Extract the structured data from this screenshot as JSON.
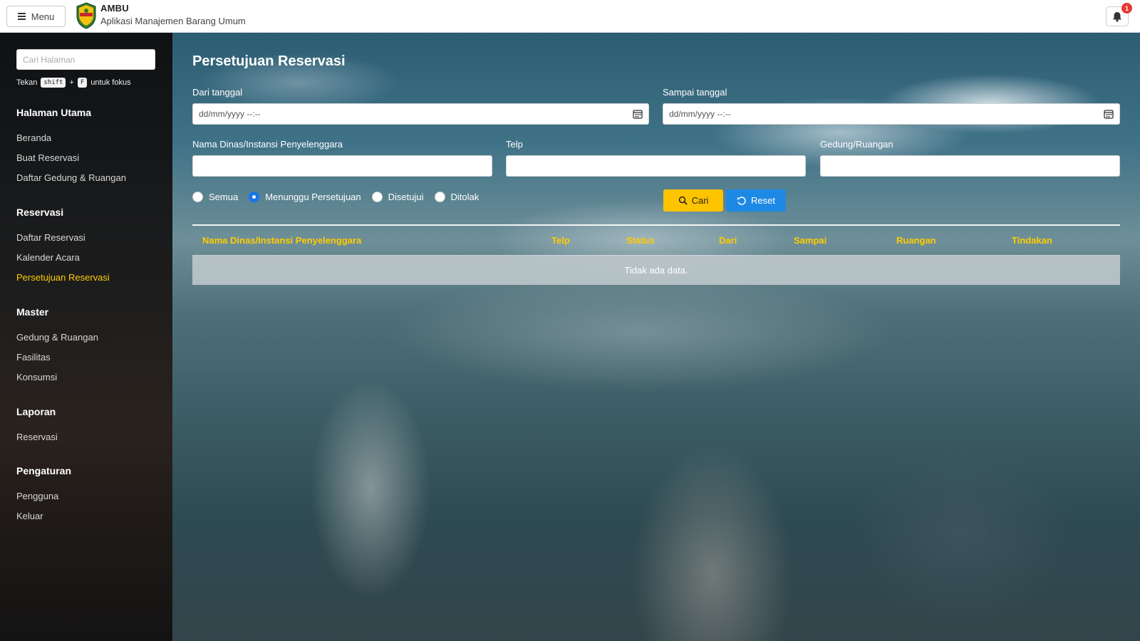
{
  "topbar": {
    "menu_label": "Menu",
    "app_name": "AMBU",
    "app_subtitle": "Aplikasi Manajemen Barang Umum",
    "notification_count": "1"
  },
  "sidebar": {
    "search_placeholder": "Cari Halaman",
    "hint_prefix": "Tekan",
    "hint_key1": "shift",
    "hint_plus": "+",
    "hint_key2": "F",
    "hint_suffix": "untuk fokus",
    "groups": [
      {
        "heading": "Halaman Utama",
        "items": [
          "Beranda",
          "Buat Reservasi",
          "Daftar Gedung & Ruangan"
        ]
      },
      {
        "heading": "Reservasi",
        "items": [
          "Daftar Reservasi",
          "Kalender Acara",
          "Persetujuan Reservasi"
        ]
      },
      {
        "heading": "Master",
        "items": [
          "Gedung & Ruangan",
          "Fasilitas",
          "Konsumsi"
        ]
      },
      {
        "heading": "Laporan",
        "items": [
          "Reservasi"
        ]
      },
      {
        "heading": "Pengaturan",
        "items": [
          "Pengguna",
          "Keluar"
        ]
      }
    ],
    "active_item": "Persetujuan Reservasi",
    "active_color": "#ffcc00"
  },
  "main": {
    "title": "Persetujuan Reservasi",
    "filters": {
      "dari_label": "Dari tanggal",
      "dari_value": "dd/mm/yyyy --:--",
      "sampai_label": "Sampai tanggal",
      "sampai_value": "dd/mm/yyyy --:--",
      "nama_label": "Nama Dinas/Instansi Penyelenggara",
      "nama_value": "",
      "telp_label": "Telp",
      "telp_value": "",
      "gedung_label": "Gedung/Ruangan",
      "gedung_value": ""
    },
    "status_options": [
      "Semua",
      "Menunggu Persetujuan",
      "Disetujui",
      "Ditolak"
    ],
    "status_selected": "Menunggu Persetujuan",
    "buttons": {
      "cari": "Cari",
      "reset": "Reset",
      "cari_color": "#ffc400",
      "reset_color": "#1e88e5"
    },
    "table": {
      "columns": [
        "Nama Dinas/Instansi Penyelenggara",
        "Telp",
        "Status",
        "Dari",
        "Sampai",
        "Ruangan",
        "Tindakan"
      ],
      "rows": [],
      "empty_text": "Tidak ada data."
    }
  }
}
